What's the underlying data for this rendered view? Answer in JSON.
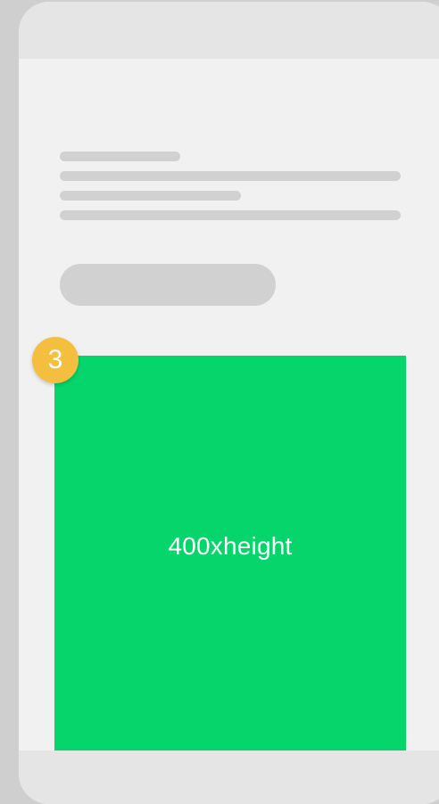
{
  "content": {
    "media_label": "400xheight",
    "step_badge": "3"
  },
  "colors": {
    "background": "#cfcfcf",
    "phone_body": "#f1f1f1",
    "bars": "#e5e5e5",
    "placeholder": "#d1d1d1",
    "media_fill": "#05d56a",
    "badge": "#f4bf3f",
    "text_on_color": "#ffffff"
  },
  "icons": []
}
